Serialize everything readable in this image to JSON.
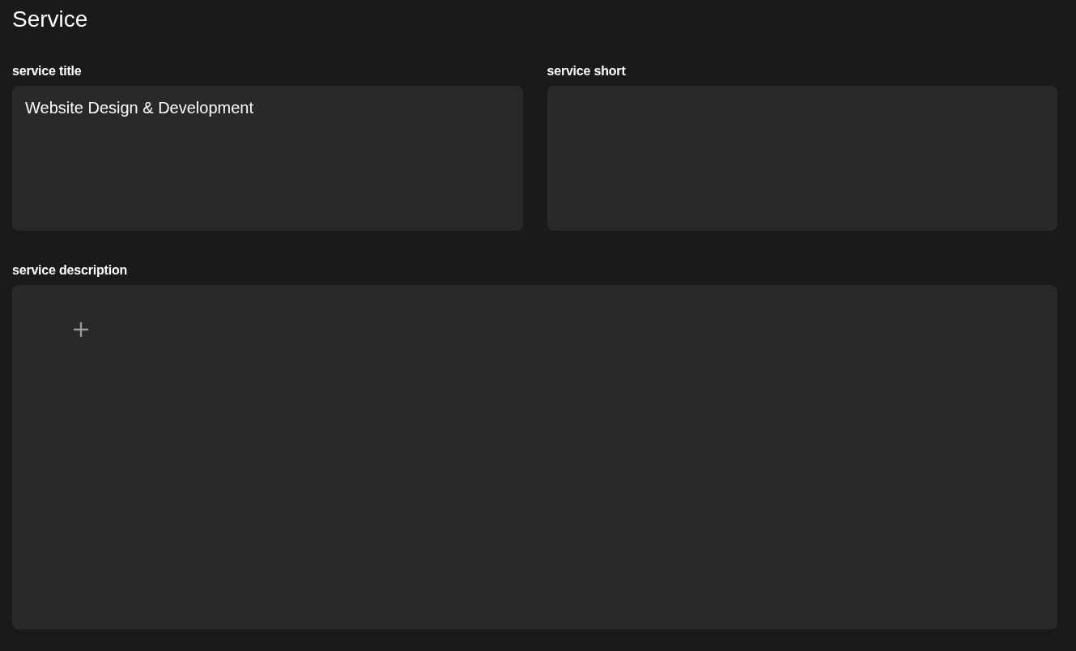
{
  "page": {
    "title": "Service"
  },
  "fields": [
    {
      "label": "service title",
      "value": "Website Design & Development"
    },
    {
      "label": "service short"
    }
  ],
  "description": {
    "label": "service description"
  }
}
